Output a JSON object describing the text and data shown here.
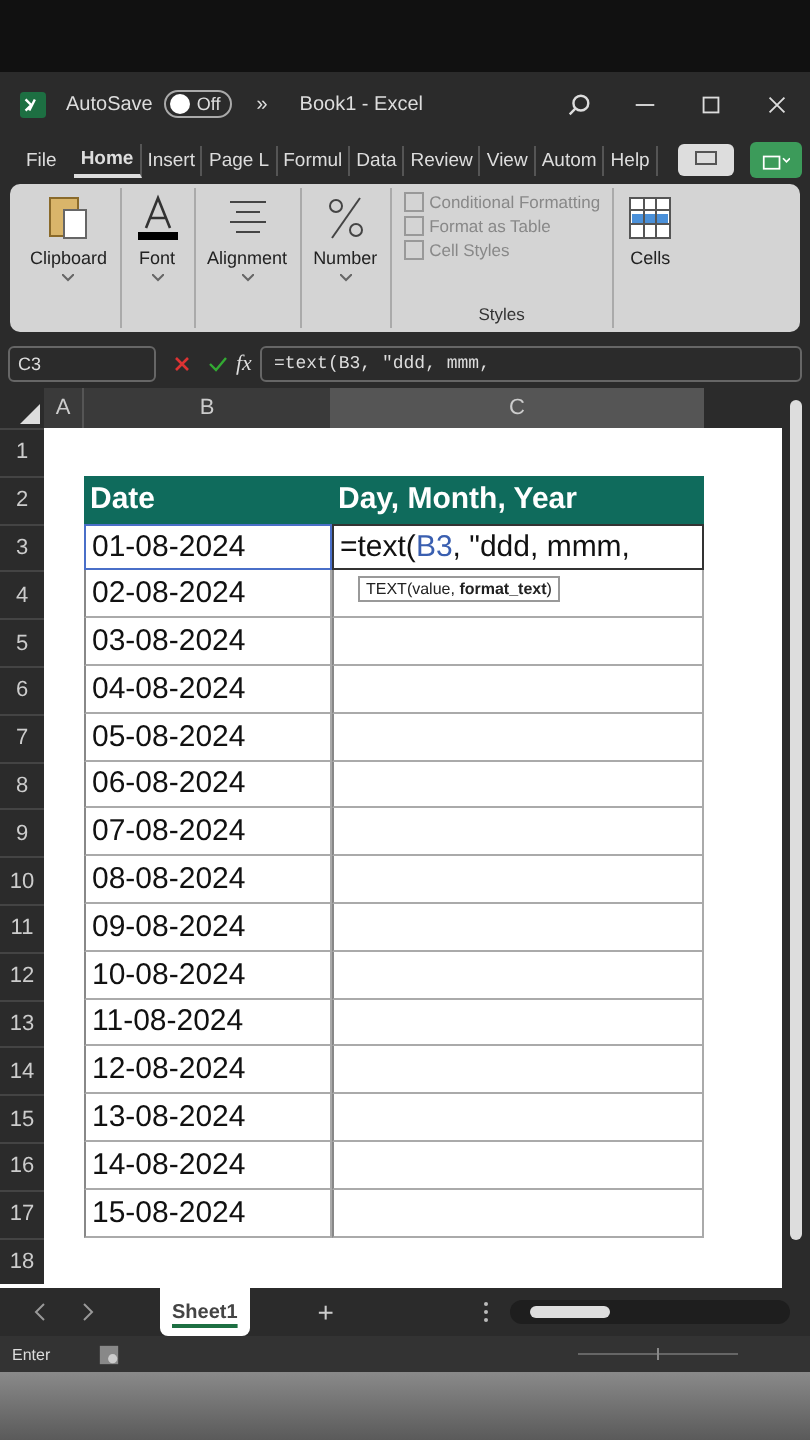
{
  "titlebar": {
    "autosave": "AutoSave",
    "toggle": {
      "label": "Off",
      "on": false
    },
    "more": "»",
    "title": "Book1  -  Excel"
  },
  "menu": [
    {
      "label": "File",
      "selected": false
    },
    {
      "label": "Home",
      "selected": true
    },
    {
      "label": "Insert",
      "selected": false
    },
    {
      "label": "Page L",
      "selected": false
    },
    {
      "label": "Formul",
      "selected": false
    },
    {
      "label": "Data",
      "selected": false
    },
    {
      "label": "Review",
      "selected": false
    },
    {
      "label": "View",
      "selected": false
    },
    {
      "label": "Autom",
      "selected": false
    },
    {
      "label": "Help",
      "selected": false
    }
  ],
  "ribbon": {
    "groups": [
      "Clipboard",
      "Font",
      "Alignment",
      "Number"
    ],
    "styles": {
      "items": [
        "Conditional Formatting",
        "Format as Table",
        "Cell Styles"
      ],
      "label": "Styles"
    },
    "cells": "Cells"
  },
  "formula_bar": {
    "name_box": "C3",
    "fx": "fx",
    "formula": "=text(B3, \"ddd, mmm,"
  },
  "columns": [
    "A",
    "B",
    "C"
  ],
  "rows": [
    "1",
    "2",
    "3",
    "4",
    "5",
    "6",
    "7",
    "8",
    "9",
    "10",
    "11",
    "12",
    "13",
    "14",
    "15",
    "16",
    "17",
    "18"
  ],
  "table": {
    "headers": [
      "Date",
      "Day, Month, Year"
    ],
    "dates": [
      "01-08-2024",
      "02-08-2024",
      "03-08-2024",
      "04-08-2024",
      "05-08-2024",
      "06-08-2024",
      "07-08-2024",
      "08-08-2024",
      "09-08-2024",
      "10-08-2024",
      "11-08-2024",
      "12-08-2024",
      "13-08-2024",
      "14-08-2024",
      "15-08-2024"
    ],
    "editing": {
      "prefix": "=text(",
      "ref": "B3",
      "suffix": ", \"ddd, mmm,"
    },
    "tooltip": "TEXT(value, **format_text**)"
  },
  "sheet_tabs": [
    {
      "label": "Sheet1",
      "selected": true
    }
  ],
  "add_sheet": "+",
  "status": "Enter"
}
